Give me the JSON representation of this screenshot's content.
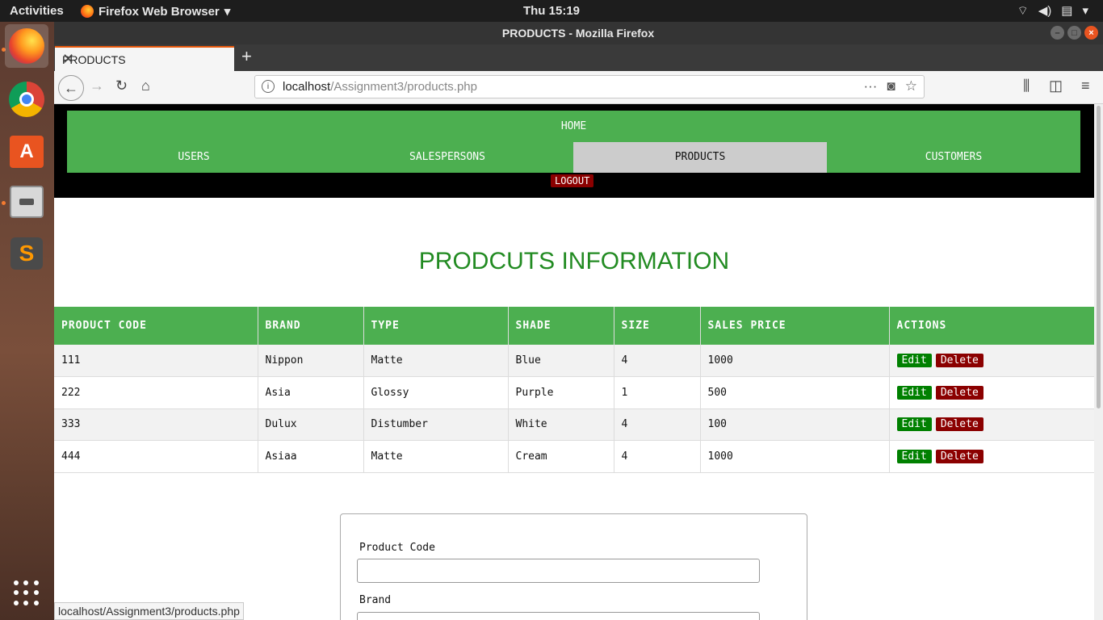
{
  "topbar": {
    "activities": "Activities",
    "app_name": "Firefox Web Browser",
    "clock": "Thu 15:19"
  },
  "window": {
    "title": "PRODUCTS - Mozilla Firefox"
  },
  "tab": {
    "label": "PRODUCTS"
  },
  "urlbar": {
    "host": "localhost",
    "path": "/Assignment3/products.php"
  },
  "site_nav": {
    "home": "HOME",
    "items": [
      "USERS",
      "SALESPERSONS",
      "PRODUCTS",
      "CUSTOMERS"
    ],
    "active": "PRODUCTS",
    "logout": "LOGOUT"
  },
  "heading": "PRODCUTS INFORMATION",
  "table": {
    "headers": [
      "PRODUCT CODE",
      "BRAND",
      "TYPE",
      "SHADE",
      "SIZE",
      "SALES PRICE",
      "ACTIONS"
    ],
    "rows": [
      [
        "111",
        "Nippon",
        "Matte",
        "Blue",
        "4",
        "1000"
      ],
      [
        "222",
        "Asia",
        "Glossy",
        "Purple",
        "1",
        "500"
      ],
      [
        "333",
        "Dulux",
        "Distumber",
        "White",
        "4",
        "100"
      ],
      [
        "444",
        "Asiaa",
        "Matte",
        "Cream",
        "4",
        "1000"
      ]
    ],
    "edit_label": "Edit",
    "delete_label": "Delete"
  },
  "form": {
    "fields": [
      {
        "label": "Product Code",
        "value": ""
      },
      {
        "label": "Brand",
        "value": ""
      }
    ]
  },
  "status_bar": "localhost/Assignment3/products.php",
  "colors": {
    "nav_green": "#4caf50",
    "active_tab": "#cccccc",
    "logout_red": "#8b0000",
    "heading_green": "#228b22",
    "edit_green": "#008000",
    "delete_red": "#8b0000"
  }
}
